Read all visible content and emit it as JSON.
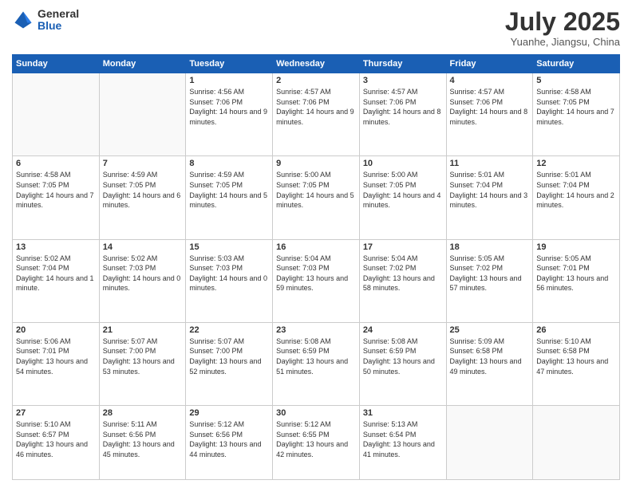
{
  "logo": {
    "general": "General",
    "blue": "Blue"
  },
  "title": "July 2025",
  "location": "Yuanhe, Jiangsu, China",
  "weekdays": [
    "Sunday",
    "Monday",
    "Tuesday",
    "Wednesday",
    "Thursday",
    "Friday",
    "Saturday"
  ],
  "weeks": [
    [
      {
        "day": "",
        "content": ""
      },
      {
        "day": "",
        "content": ""
      },
      {
        "day": "1",
        "content": "Sunrise: 4:56 AM\nSunset: 7:06 PM\nDaylight: 14 hours and 9 minutes."
      },
      {
        "day": "2",
        "content": "Sunrise: 4:57 AM\nSunset: 7:06 PM\nDaylight: 14 hours and 9 minutes."
      },
      {
        "day": "3",
        "content": "Sunrise: 4:57 AM\nSunset: 7:06 PM\nDaylight: 14 hours and 8 minutes."
      },
      {
        "day": "4",
        "content": "Sunrise: 4:57 AM\nSunset: 7:06 PM\nDaylight: 14 hours and 8 minutes."
      },
      {
        "day": "5",
        "content": "Sunrise: 4:58 AM\nSunset: 7:05 PM\nDaylight: 14 hours and 7 minutes."
      }
    ],
    [
      {
        "day": "6",
        "content": "Sunrise: 4:58 AM\nSunset: 7:05 PM\nDaylight: 14 hours and 7 minutes."
      },
      {
        "day": "7",
        "content": "Sunrise: 4:59 AM\nSunset: 7:05 PM\nDaylight: 14 hours and 6 minutes."
      },
      {
        "day": "8",
        "content": "Sunrise: 4:59 AM\nSunset: 7:05 PM\nDaylight: 14 hours and 5 minutes."
      },
      {
        "day": "9",
        "content": "Sunrise: 5:00 AM\nSunset: 7:05 PM\nDaylight: 14 hours and 5 minutes."
      },
      {
        "day": "10",
        "content": "Sunrise: 5:00 AM\nSunset: 7:05 PM\nDaylight: 14 hours and 4 minutes."
      },
      {
        "day": "11",
        "content": "Sunrise: 5:01 AM\nSunset: 7:04 PM\nDaylight: 14 hours and 3 minutes."
      },
      {
        "day": "12",
        "content": "Sunrise: 5:01 AM\nSunset: 7:04 PM\nDaylight: 14 hours and 2 minutes."
      }
    ],
    [
      {
        "day": "13",
        "content": "Sunrise: 5:02 AM\nSunset: 7:04 PM\nDaylight: 14 hours and 1 minute."
      },
      {
        "day": "14",
        "content": "Sunrise: 5:02 AM\nSunset: 7:03 PM\nDaylight: 14 hours and 0 minutes."
      },
      {
        "day": "15",
        "content": "Sunrise: 5:03 AM\nSunset: 7:03 PM\nDaylight: 14 hours and 0 minutes."
      },
      {
        "day": "16",
        "content": "Sunrise: 5:04 AM\nSunset: 7:03 PM\nDaylight: 13 hours and 59 minutes."
      },
      {
        "day": "17",
        "content": "Sunrise: 5:04 AM\nSunset: 7:02 PM\nDaylight: 13 hours and 58 minutes."
      },
      {
        "day": "18",
        "content": "Sunrise: 5:05 AM\nSunset: 7:02 PM\nDaylight: 13 hours and 57 minutes."
      },
      {
        "day": "19",
        "content": "Sunrise: 5:05 AM\nSunset: 7:01 PM\nDaylight: 13 hours and 56 minutes."
      }
    ],
    [
      {
        "day": "20",
        "content": "Sunrise: 5:06 AM\nSunset: 7:01 PM\nDaylight: 13 hours and 54 minutes."
      },
      {
        "day": "21",
        "content": "Sunrise: 5:07 AM\nSunset: 7:00 PM\nDaylight: 13 hours and 53 minutes."
      },
      {
        "day": "22",
        "content": "Sunrise: 5:07 AM\nSunset: 7:00 PM\nDaylight: 13 hours and 52 minutes."
      },
      {
        "day": "23",
        "content": "Sunrise: 5:08 AM\nSunset: 6:59 PM\nDaylight: 13 hours and 51 minutes."
      },
      {
        "day": "24",
        "content": "Sunrise: 5:08 AM\nSunset: 6:59 PM\nDaylight: 13 hours and 50 minutes."
      },
      {
        "day": "25",
        "content": "Sunrise: 5:09 AM\nSunset: 6:58 PM\nDaylight: 13 hours and 49 minutes."
      },
      {
        "day": "26",
        "content": "Sunrise: 5:10 AM\nSunset: 6:58 PM\nDaylight: 13 hours and 47 minutes."
      }
    ],
    [
      {
        "day": "27",
        "content": "Sunrise: 5:10 AM\nSunset: 6:57 PM\nDaylight: 13 hours and 46 minutes."
      },
      {
        "day": "28",
        "content": "Sunrise: 5:11 AM\nSunset: 6:56 PM\nDaylight: 13 hours and 45 minutes."
      },
      {
        "day": "29",
        "content": "Sunrise: 5:12 AM\nSunset: 6:56 PM\nDaylight: 13 hours and 44 minutes."
      },
      {
        "day": "30",
        "content": "Sunrise: 5:12 AM\nSunset: 6:55 PM\nDaylight: 13 hours and 42 minutes."
      },
      {
        "day": "31",
        "content": "Sunrise: 5:13 AM\nSunset: 6:54 PM\nDaylight: 13 hours and 41 minutes."
      },
      {
        "day": "",
        "content": ""
      },
      {
        "day": "",
        "content": ""
      }
    ]
  ]
}
